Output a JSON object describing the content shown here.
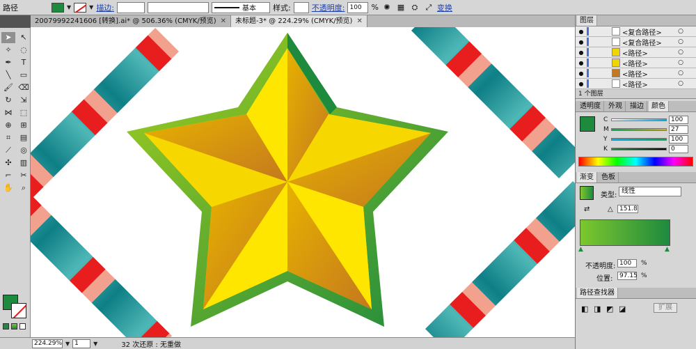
{
  "control_bar": {
    "mode_label": "路径",
    "stroke_label": "描边:",
    "brush_label": "基本",
    "style_label": "样式:",
    "opacity_label": "不透明度:",
    "opacity_value": "100",
    "opacity_unit": "%",
    "transform_label": "变换"
  },
  "doc_tabs": [
    {
      "label": "20079992241606 [转换].ai* @ 506.36% (CMYK/预览)"
    },
    {
      "label": "未标题-3* @ 224.29% (CMYK/预览)"
    }
  ],
  "status": {
    "zoom": "224.29%",
    "page": "1",
    "undo_text": "32 次还原 : 无重做"
  },
  "layers_panel": {
    "title": "图层",
    "items": [
      {
        "label": "<复合路径>"
      },
      {
        "label": "<复合路径>"
      },
      {
        "label": "<路径>"
      },
      {
        "label": "<路径>"
      },
      {
        "label": "<路径>"
      },
      {
        "label": "<路径>"
      }
    ],
    "footer": "1 个图层"
  },
  "color_panel": {
    "tabs": [
      "透明度",
      "外观",
      "描边",
      "颜色"
    ],
    "channels": [
      {
        "name": "C",
        "value": "100"
      },
      {
        "name": "M",
        "value": "27"
      },
      {
        "name": "Y",
        "value": "100"
      },
      {
        "name": "K",
        "value": "0"
      }
    ]
  },
  "gradient_panel": {
    "tabs": [
      "渐变",
      "色板"
    ],
    "type_label": "类型:",
    "type_value": "线性",
    "angle_value": "151.8",
    "opacity_label": "不透明度:",
    "opacity_value": "100",
    "position_label": "位置:",
    "position_value": "97.15",
    "unit": "%"
  },
  "pathfinder_panel": {
    "title": "路径查找器",
    "expand_button": "扩展"
  },
  "colors": {
    "fill": "#1e8a3e",
    "gradient_start": "#7dc72e",
    "gradient_end": "#1e8a3e"
  }
}
